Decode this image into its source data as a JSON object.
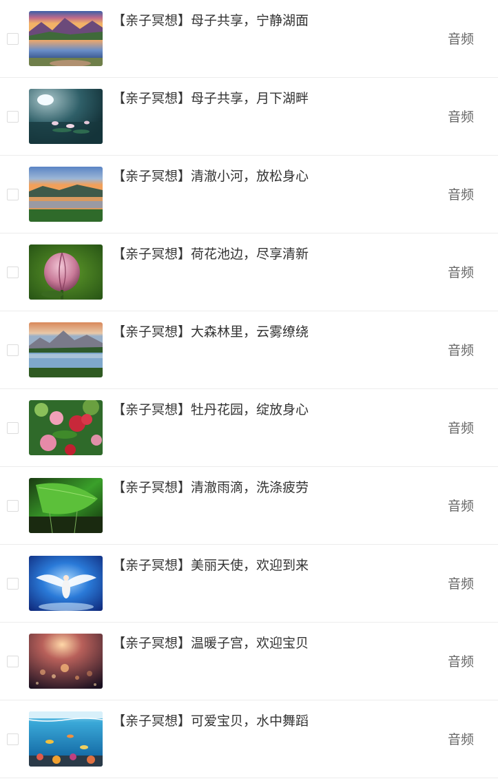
{
  "items": [
    {
      "title": "【亲子冥想】母子共享，宁静湖面",
      "type": "音频",
      "thumbnail": "sunset-mountain-lake-image"
    },
    {
      "title": "【亲子冥想】母子共享，月下湖畔",
      "type": "音频",
      "thumbnail": "moonlit-lotus-pond-image"
    },
    {
      "title": "【亲子冥想】清澈小河，放松身心",
      "type": "音频",
      "thumbnail": "river-sunset-image"
    },
    {
      "title": "【亲子冥想】荷花池边，尽享清新",
      "type": "音频",
      "thumbnail": "lotus-bud-image"
    },
    {
      "title": "【亲子冥想】大森林里，云雾缭绕",
      "type": "音频",
      "thumbnail": "forest-mountain-lake-image"
    },
    {
      "title": "【亲子冥想】牡丹花园，绽放身心",
      "type": "音频",
      "thumbnail": "peony-garden-image"
    },
    {
      "title": "【亲子冥想】清澈雨滴，洗涤疲劳",
      "type": "音频",
      "thumbnail": "green-leaf-raindrop-image"
    },
    {
      "title": "【亲子冥想】美丽天使，欢迎到来",
      "type": "音频",
      "thumbnail": "angel-light-image"
    },
    {
      "title": "【亲子冥想】温暖子宫，欢迎宝贝",
      "type": "音频",
      "thumbnail": "warm-bokeh-image"
    },
    {
      "title": "【亲子冥想】可爱宝贝，水中舞蹈",
      "type": "音频",
      "thumbnail": "underwater-reef-image"
    }
  ]
}
